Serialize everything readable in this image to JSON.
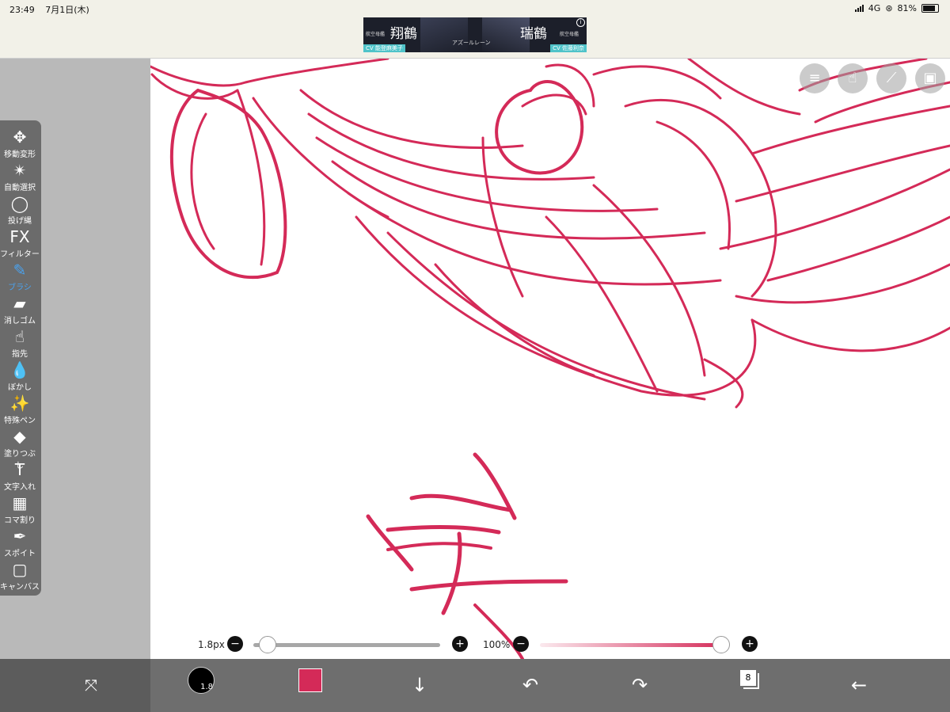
{
  "status_bar": {
    "time": "23:49",
    "date": "7月1日(木)",
    "network": "4G",
    "battery_percent": "81%",
    "battery_level": 0.81
  },
  "ad": {
    "left_small": "航空母艦",
    "left_title": "翔鶴",
    "center_text": "アズールレーン",
    "right_title": "瑞鶴",
    "right_small": "航空母艦",
    "left_cv": "CV 能登麻美子",
    "right_cv": "CV 佐藤利奈",
    "info_label": "i"
  },
  "tools": [
    {
      "label": "移動変形",
      "icon": "move-icon",
      "glyph": "✥"
    },
    {
      "label": "自動選択",
      "icon": "magic-wand-icon",
      "glyph": "✴"
    },
    {
      "label": "投げ縄",
      "icon": "lasso-icon",
      "glyph": "◯"
    },
    {
      "label": "フィルター",
      "icon": "fx-icon",
      "glyph": "FX"
    },
    {
      "label": "ブラシ",
      "icon": "brush-icon",
      "glyph": "✎",
      "active": true
    },
    {
      "label": "消しゴム",
      "icon": "eraser-icon",
      "glyph": "▰"
    },
    {
      "label": "指先",
      "icon": "finger-icon",
      "glyph": "☝"
    },
    {
      "label": "ぼかし",
      "icon": "drop-icon",
      "glyph": "💧"
    },
    {
      "label": "特殊ペン",
      "icon": "special-pen-icon",
      "glyph": "✨"
    },
    {
      "label": "塗りつぶし",
      "icon": "bucket-icon",
      "glyph": "◆"
    },
    {
      "label": "文字入れ",
      "icon": "text-icon",
      "glyph": "T"
    },
    {
      "label": "コマ割り",
      "icon": "panel-icon",
      "glyph": "▦"
    },
    {
      "label": "スポイト",
      "icon": "eyedropper-icon",
      "glyph": "✒"
    },
    {
      "label": "キャンバス",
      "icon": "canvas-icon",
      "glyph": "▢"
    }
  ],
  "canvas_buttons": [
    {
      "name": "menu-icon",
      "glyph": "≡"
    },
    {
      "name": "hand-icon",
      "glyph": "☝"
    },
    {
      "name": "ruler-icon",
      "glyph": "⟋"
    },
    {
      "name": "image-icon",
      "glyph": "▣"
    }
  ],
  "brush": {
    "size_label": "1.8px",
    "size_slider": 0.0,
    "opacity_label": "100%",
    "opacity_slider": 1.0,
    "bottom_size_label": "1.8"
  },
  "colors": {
    "brush": "#d42a58",
    "active_tool": "#4aa3f0"
  },
  "bottom_bar": {
    "transform_icon": "rotate-icon",
    "down_arrow": "↓",
    "undo": "↶",
    "redo": "↷",
    "layer_count": "8",
    "back": "←"
  }
}
